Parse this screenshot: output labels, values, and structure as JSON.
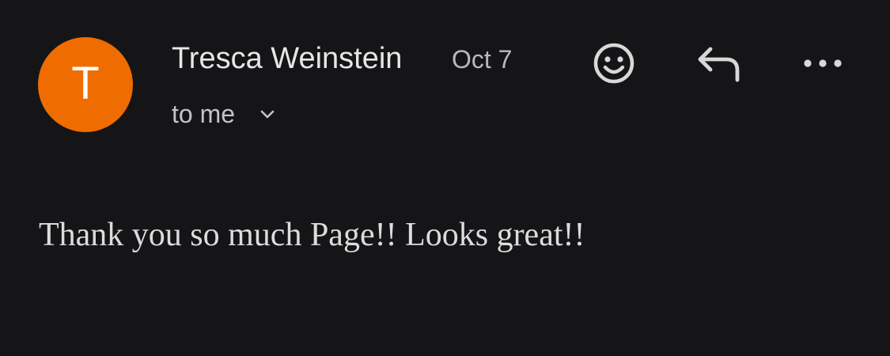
{
  "sender": {
    "avatar_letter": "T",
    "avatar_color": "#ef6c00",
    "name": "Tresca Weinstein",
    "date": "Oct 7"
  },
  "recipient": {
    "label": "to me",
    "expand_icon": "chevron-down-icon"
  },
  "actions": [
    {
      "icon": "emoji-reaction-icon"
    },
    {
      "icon": "reply-icon"
    },
    {
      "icon": "more-options-icon"
    }
  ],
  "message": {
    "body": "Thank you so much Page!! Looks great!!"
  },
  "colors": {
    "background": "#151517",
    "text": "#e3e3e3",
    "secondary_text": "#b9b9bd"
  }
}
